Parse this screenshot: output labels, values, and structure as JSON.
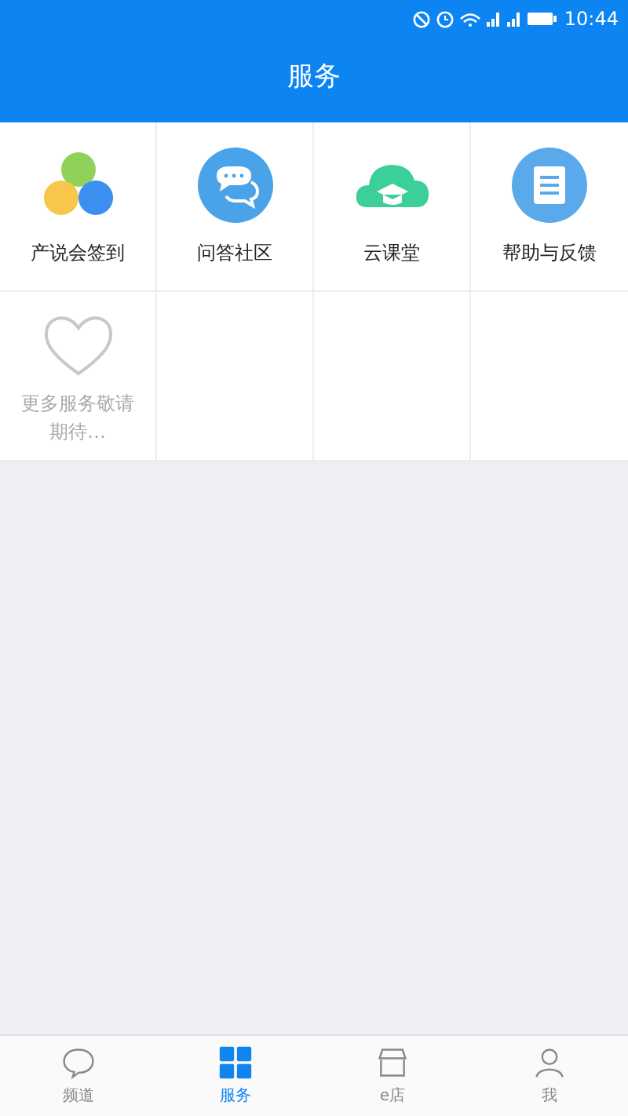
{
  "status_bar": {
    "time": "10:44"
  },
  "header": {
    "title": "服务"
  },
  "services": [
    {
      "kind": "service",
      "label": "产说会签到"
    },
    {
      "kind": "service",
      "label": "问答社区"
    },
    {
      "kind": "service",
      "label": "云课堂"
    },
    {
      "kind": "service",
      "label": "帮助与反馈"
    },
    {
      "kind": "placeholder",
      "label": "更多服务敬请期待…"
    }
  ],
  "tabs": [
    {
      "label": "频道",
      "selected": false
    },
    {
      "label": "服务",
      "selected": true
    },
    {
      "label": "e店",
      "selected": false
    },
    {
      "label": "我",
      "selected": false
    }
  ]
}
